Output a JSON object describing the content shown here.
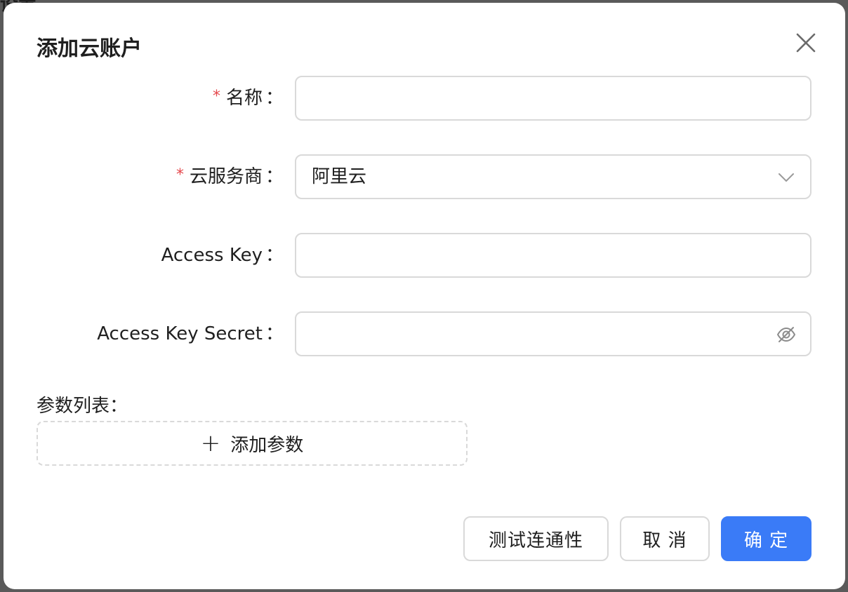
{
  "backdrop": {
    "text": "设置"
  },
  "modal": {
    "title": "添加云账户",
    "close_icon": "close-icon"
  },
  "form": {
    "name": {
      "label": "名称",
      "required": true,
      "value": ""
    },
    "provider": {
      "label": "云服务商",
      "required": true,
      "value": "阿里云",
      "icon": "chevron-down-icon"
    },
    "access_key": {
      "label": "Access Key",
      "required": false,
      "value": ""
    },
    "access_key_secret": {
      "label": "Access Key Secret",
      "required": false,
      "value": "",
      "icon": "eye-off-icon"
    },
    "colon": "："
  },
  "params": {
    "label": "参数列表：",
    "add_button": "添加参数",
    "add_icon": "plus-icon"
  },
  "footer": {
    "test_button": "测试连通性",
    "cancel_button": "取 消",
    "confirm_button": "确 定"
  },
  "colors": {
    "primary": "#3a7bf7",
    "required": "#e5484d",
    "border": "#d9d9d9"
  }
}
